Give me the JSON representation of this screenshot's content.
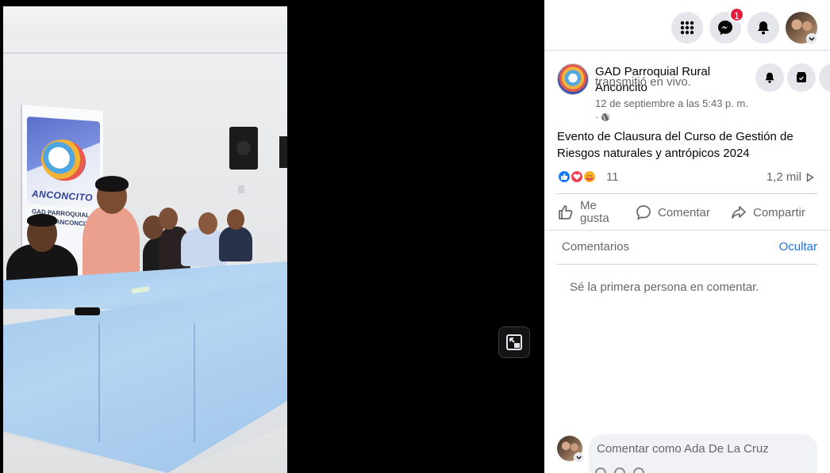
{
  "topbar": {
    "icons": [
      "menu-grid-icon",
      "messenger-icon",
      "notification-bell-icon"
    ],
    "messenger_badge": "1"
  },
  "post": {
    "page_name": "GAD Parroquial Rural Anconcito",
    "action": "transmitió en vivo.",
    "date": "12 de septiembre a las 5:43 p. m.",
    "privacy_dot": "·",
    "text": "Evento de Clausura del Curso de Gestión de Riesgos naturales y antrópicos 2024",
    "reaction_count": "11",
    "views": "1,2 mil",
    "actions": {
      "like": "Me gusta",
      "comment": "Comentar",
      "share": "Compartir"
    }
  },
  "comments": {
    "label": "Comentarios",
    "hide": "Ocultar",
    "empty": "Sé la primera persona en comentar.",
    "composer_placeholder": "Comentar como Ada De La Cruz"
  },
  "video": {
    "banner_title": "ANCONCITO",
    "banner_sub": "GAD PARROQUIAL RURAL ANCONCITO"
  },
  "colors": {
    "accent_blue": "#216fdb",
    "badge_red": "#e41e3f",
    "icon_bg": "#e4e6eb",
    "video_bg": "#000000"
  }
}
